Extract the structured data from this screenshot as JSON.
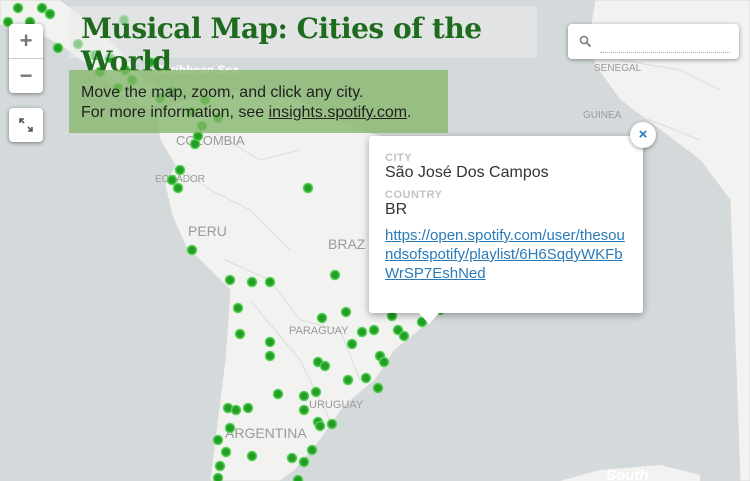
{
  "title": "Musical Map: Cities of the World",
  "info": {
    "line1": "Move the map, zoom, and click any city.",
    "line2_prefix": "For more information, see ",
    "line2_link": "insights.spotify.com",
    "line2_suffix": "."
  },
  "zoom": {
    "in_label": "+",
    "out_label": "−"
  },
  "search": {
    "placeholder": ""
  },
  "popup": {
    "city_label": "CITY",
    "city": "São José Dos Campos",
    "country_label": "COUNTRY",
    "country": "BR",
    "link": "https://open.spotify.com/user/thesoundsofspotify/playlist/6H6SqdyWKFbWrSP7EshNed",
    "close_label": "×"
  },
  "map_labels": {
    "caribbean": "Caribbean Sea",
    "colombia": "COLOMBIA",
    "ecuador": "ECUADOR",
    "peru": "PERU",
    "brazil": "BRAZ",
    "paraguay": "PARAGUAY",
    "uruguay": "URUGUAY",
    "argentina": "ARGENTINA",
    "senegal": "SENEGAL",
    "guinea": "GUINEA",
    "south": "South"
  },
  "colors": {
    "land": "#f2f2f0",
    "water": "#d4dadc",
    "dot": "#1a9a1a",
    "title": "#1e6b1e",
    "link": "#2a7ab8"
  }
}
